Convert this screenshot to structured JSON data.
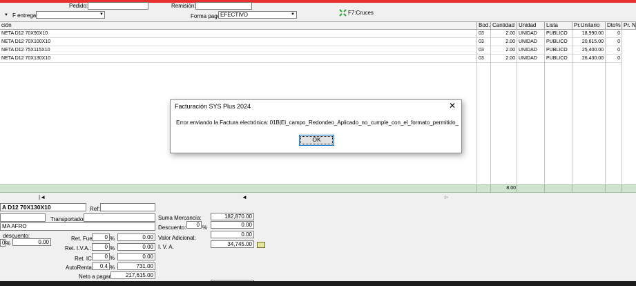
{
  "header": {
    "pedido_label": "Pedido:",
    "remision_label": "Remisión:",
    "f_entrega_label": "F entrega:",
    "forma_pago_label": "Forma pago:",
    "forma_pago_value": "EFECTIVO",
    "cruces_label": "F7:Cruces"
  },
  "grid": {
    "columns": [
      "ción",
      "Bod.",
      "Cantidad",
      "Unidad",
      "Lista",
      "Pr.Unitario",
      "Dto%",
      "Pr. N"
    ],
    "rows": [
      {
        "desc": "NETA D12 70X90X10",
        "bod": "03",
        "cant": "2.00",
        "unidad": "UNIDAD",
        "lista": "PUBLICO",
        "precio": "18,990.00",
        "dto": "0"
      },
      {
        "desc": "NETA D12 70X100X10",
        "bod": "03",
        "cant": "2.00",
        "unidad": "UNIDAD",
        "lista": "PUBLICO",
        "precio": "20,615.00",
        "dto": "0"
      },
      {
        "desc": "NETA D12 75X115X10",
        "bod": "03",
        "cant": "2.00",
        "unidad": "UNIDAD",
        "lista": "PUBLICO",
        "precio": "25,400.00",
        "dto": "0"
      },
      {
        "desc": "NETA D12 70X130X10",
        "bod": "03",
        "cant": "2.00",
        "unidad": "UNIDAD",
        "lista": "PUBLICO",
        "precio": "26,430.00",
        "dto": "0"
      }
    ],
    "total_cantidad": "8.00"
  },
  "dialog": {
    "title": "Facturación SYS Plus 2024",
    "message": "Error enviando la Factura electrónica: 01B|El_campo_Redondeo_Aplicado_no_cumple_con_el_formato_permitido_",
    "ok_label": "OK"
  },
  "detail": {
    "product": "A D12 70X130X10",
    "ref_label": "Ref:",
    "transportador_label": "Transportador:",
    "cliente": "MA AFRO",
    "descuento_label": "descuento:",
    "descuento_pct": "0",
    "descuento_value": "0.00",
    "pct_symbol": "%"
  },
  "retenciones": {
    "ret_fuente_label": "Ret. Fuente:",
    "ret_fuente_pct": "0",
    "ret_fuente_value": "0.00",
    "ret_iva_label": "Ret. I.V.A.:",
    "ret_iva_pct": "0",
    "ret_iva_value": "0.00",
    "ret_ica_label": "Ret. ICA:",
    "ret_ica_pct": "0",
    "ret_ica_value": "0.00",
    "autorenta_label": "AutoRenta:",
    "autorenta_pct": "0.4",
    "autorenta_value": "731.00",
    "neto_label": "Neto a pagar:",
    "neto_value": "217,615.00"
  },
  "totales": {
    "suma_label": "Suma Mercancía:",
    "suma_value": "182,870.00",
    "descuento_label": "Descuento:",
    "descuento_pct": "0",
    "descuento_value": "0.00",
    "valor_adicional_label": "Valor Adicional:",
    "valor_adicional_value": "0.00",
    "iva_label": "I. V. A.",
    "iva_value": "34,745.00"
  }
}
